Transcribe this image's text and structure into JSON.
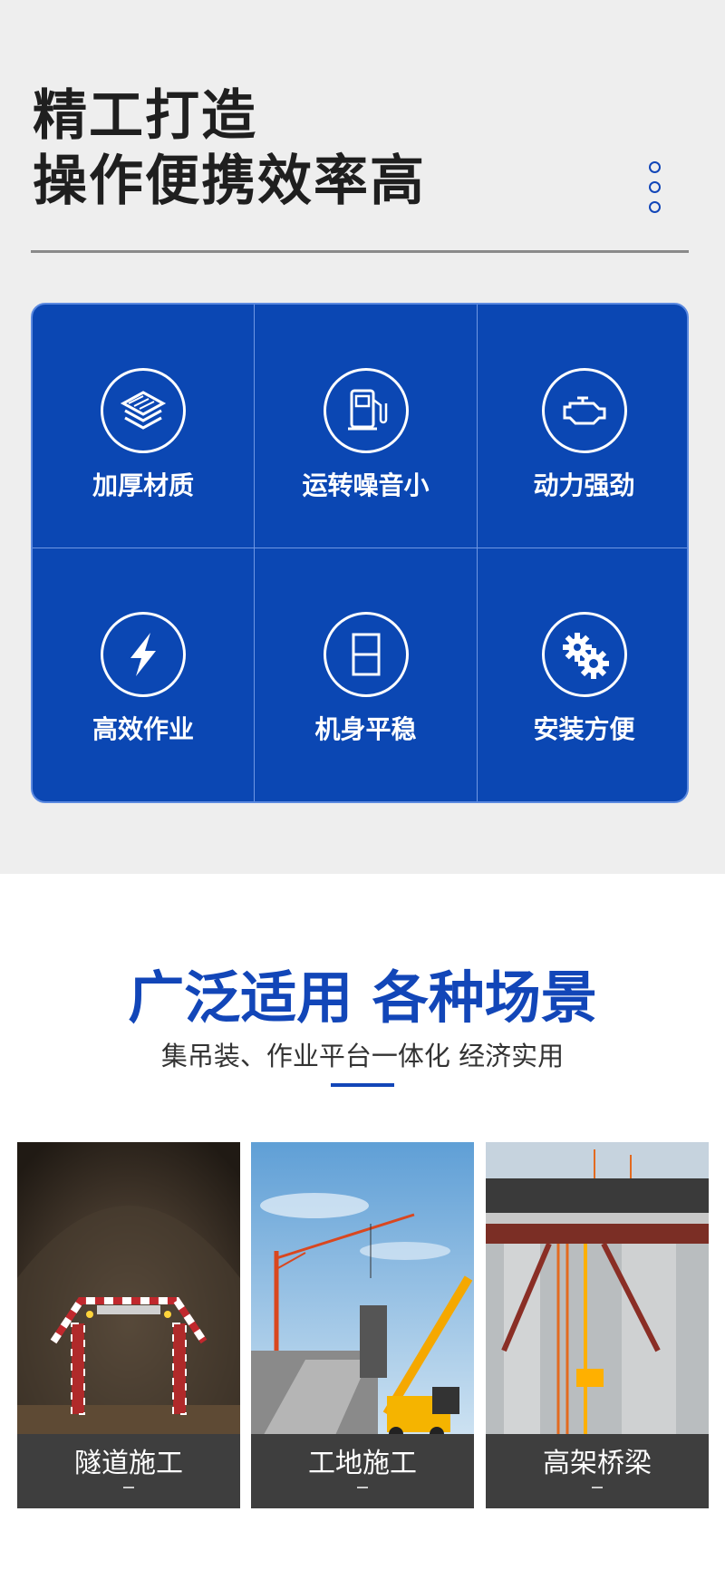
{
  "headline": {
    "line1": "精工打造",
    "line2": "操作便携效率高"
  },
  "features": [
    {
      "label": "加厚材质",
      "icon": "layers-icon"
    },
    {
      "label": "运转噪音小",
      "icon": "fuel-pump-icon"
    },
    {
      "label": "动力强劲",
      "icon": "engine-icon"
    },
    {
      "label": "高效作业",
      "icon": "lightning-icon"
    },
    {
      "label": "机身平稳",
      "icon": "stable-frame-icon"
    },
    {
      "label": "安装方便",
      "icon": "gears-icon"
    }
  ],
  "scenes": {
    "title": "广泛适用 各种场景",
    "subtitle": "集吊装、作业平台一体化 经济实用",
    "cards": [
      {
        "label": "隧道施工"
      },
      {
        "label": "工地施工"
      },
      {
        "label": "高架桥梁"
      }
    ]
  },
  "colors": {
    "brand_blue": "#0b47b3",
    "title_blue": "#1246b8",
    "background_gray": "#eeeeee"
  }
}
